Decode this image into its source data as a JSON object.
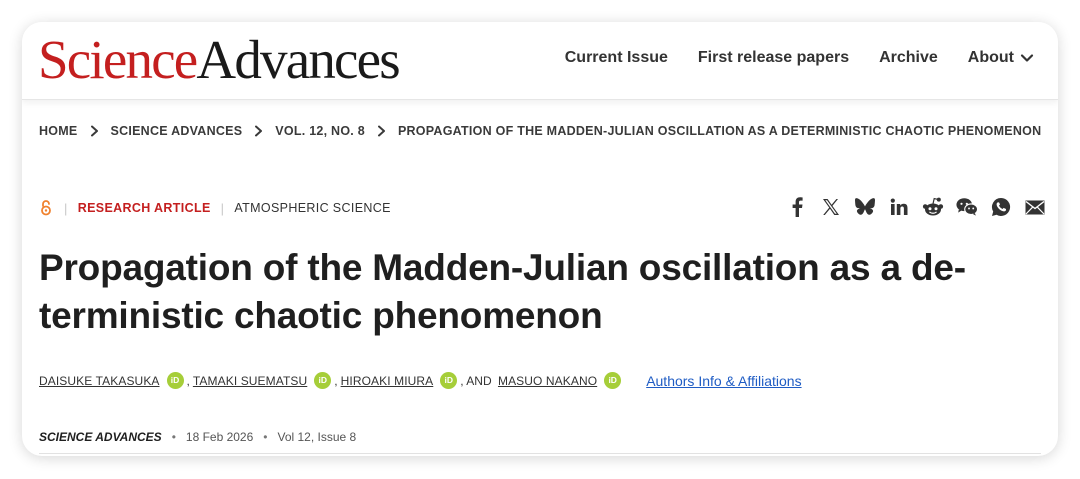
{
  "brand": {
    "word1": "Science",
    "word2": "Advances",
    "color_primary": "#c41f1f"
  },
  "nav": {
    "items": [
      "Current Issue",
      "First release papers",
      "Archive",
      "About"
    ],
    "about_icon": "chevron-down-icon"
  },
  "breadcrumb": [
    "HOME",
    "SCIENCE ADVANCES",
    "VOL. 12, NO. 8",
    "PROPAGATION OF THE MADDEN-JULIAN OSCILLATION AS A DETERMINISTIC CHAOTIC PHENOMENON"
  ],
  "article": {
    "access_icon": "open-access-icon",
    "type": "RESEARCH ARTICLE",
    "subject": "ATMOSPHERIC SCIENCE",
    "title": "Propagation of the Madden-Julian oscillation as a de-terministic chaotic phenomenon",
    "title_line1": "Propagation of the Madden-Julian oscillation as a de-",
    "title_line2": "terministic chaotic phenomenon",
    "authors": [
      "DAISUKE TAKASUKA",
      "TAMAKI SUEMATSU",
      "HIROAKI MIURA",
      "MASUO NAKANO"
    ],
    "author_separators": [
      ",",
      ",",
      ", AND"
    ],
    "orcid_label": "iD",
    "affiliations_link": "Authors Info & Affiliations",
    "journal": "SCIENCE ADVANCES",
    "date": "18 Feb 2026",
    "volume": "Vol 12, Issue 8",
    "pub_separator": "•"
  },
  "share_icons": [
    "facebook-icon",
    "x-icon",
    "bluesky-icon",
    "linkedin-icon",
    "reddit-icon",
    "wechat-icon",
    "whatsapp-icon",
    "email-icon"
  ],
  "colors": {
    "orcid_green": "#a6ce39",
    "link_blue": "#1f5cc4",
    "open_access_orange": "#f0822f"
  }
}
